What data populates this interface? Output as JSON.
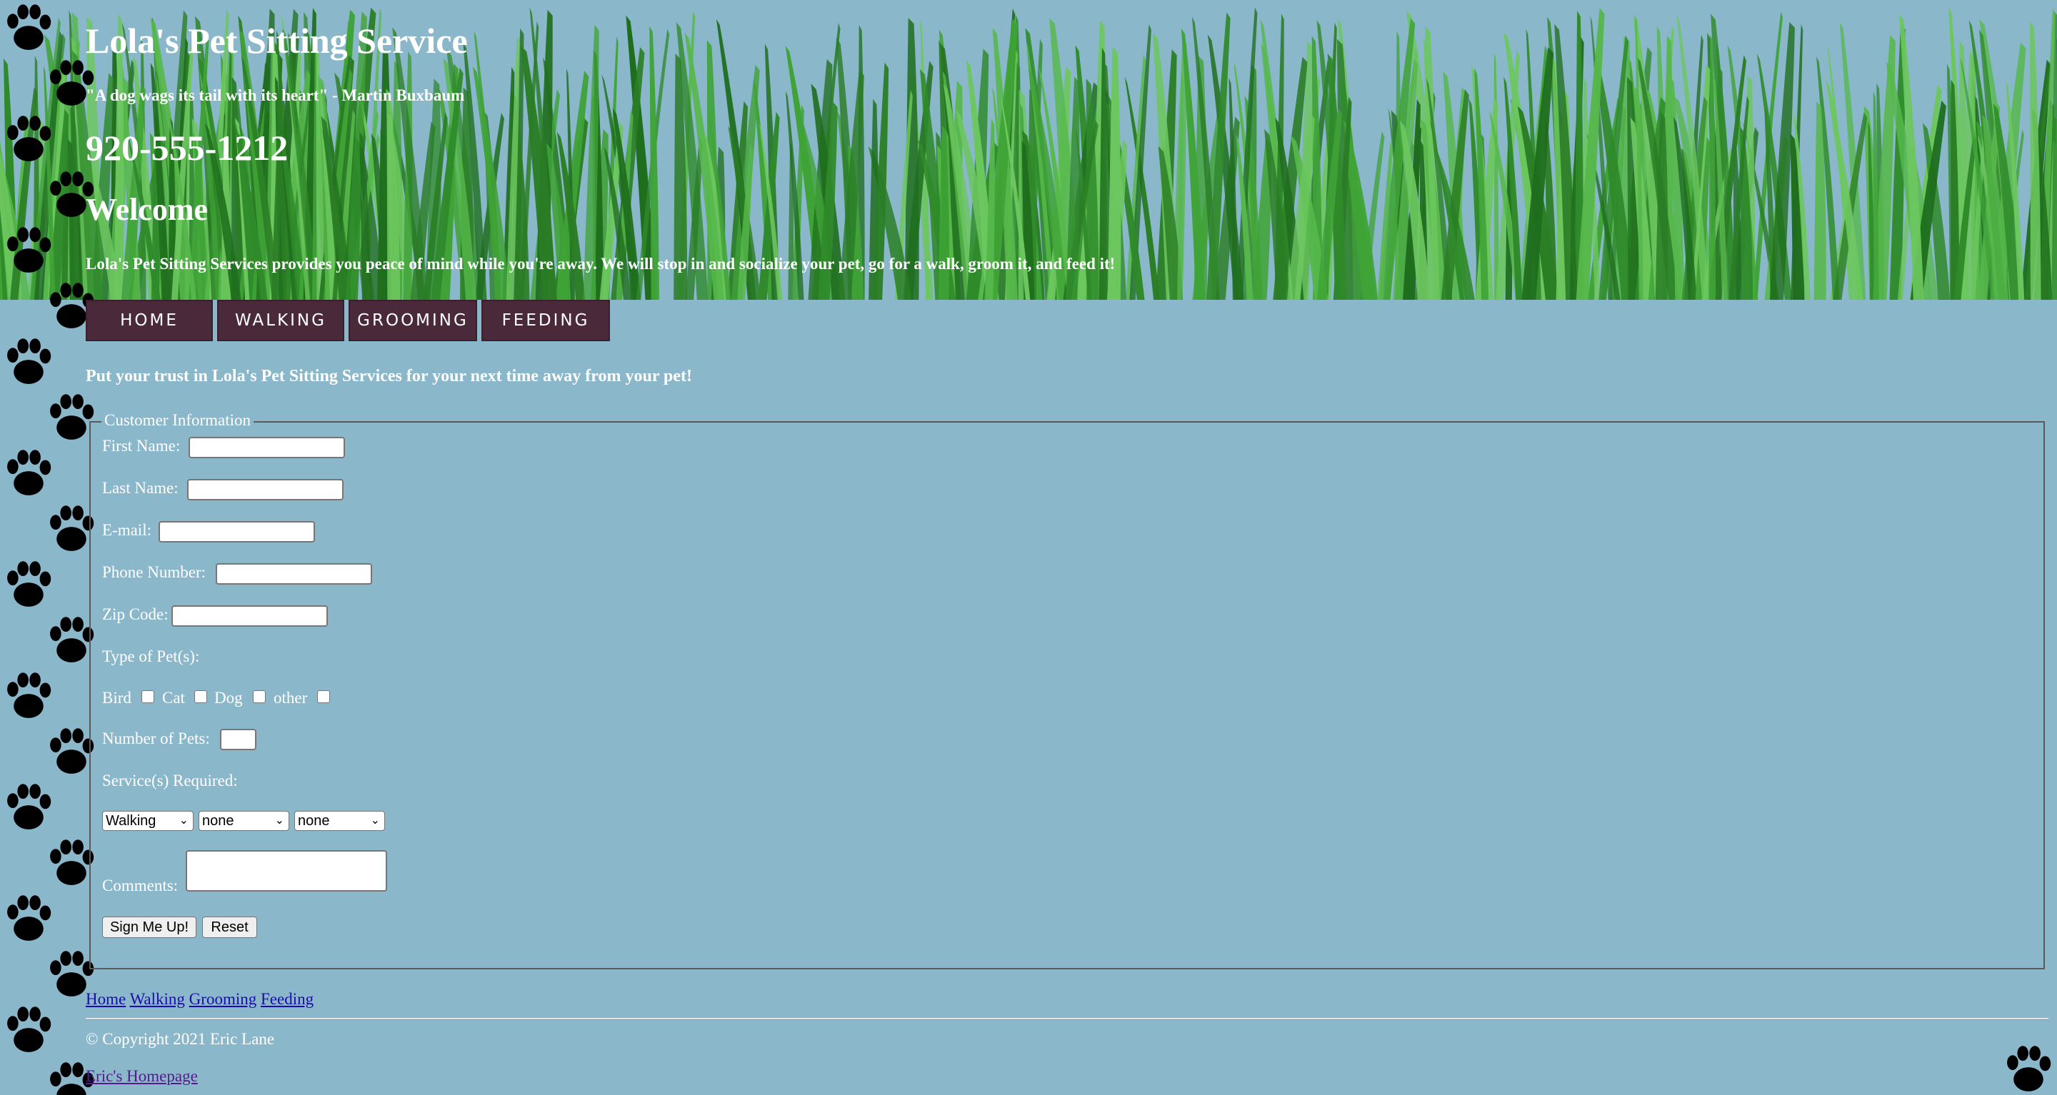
{
  "header": {
    "title": "Lola's Pet Sitting Service",
    "quote": "\"A dog wags its tail with its heart\" - Martin Buxbaum",
    "phone": "920-555-1212",
    "welcome": "Welcome",
    "intro": "Lola's Pet Sitting Services provides you peace of mind while you're away. We will stop in and socialize your pet, go for a walk, groom it, and feed it!"
  },
  "nav": {
    "items": [
      {
        "label": "HOME"
      },
      {
        "label": "WALKING"
      },
      {
        "label": "GROOMING"
      },
      {
        "label": "FEEDING"
      }
    ],
    "color": "#4a2a3a"
  },
  "trust_text": "Put your trust in Lola's Pet Sitting Services for your next time away from your pet!",
  "form": {
    "legend": "Customer Information",
    "first_name_label": "First Name:",
    "last_name_label": "Last Name:",
    "email_label": "E-mail:",
    "phone_label": "Phone Number:",
    "zip_label": "Zip Code:",
    "pet_type_label": "Type of Pet(s):",
    "pets": [
      "Bird",
      "Cat",
      "Dog",
      "other"
    ],
    "num_pets_label": "Number of Pets:",
    "services_label": "Service(s) Required:",
    "services_selected": [
      "Walking",
      "none",
      "none"
    ],
    "comments_label": "Comments:",
    "submit_label": "Sign Me Up!",
    "reset_label": "Reset"
  },
  "footer": {
    "links": [
      "Home",
      "Walking",
      "Grooming",
      "Feeding"
    ],
    "copyright": "© Copyright 2021 Eric Lane",
    "homepage": "Eric's Homepage"
  },
  "colors": {
    "background": "#8bb7cb",
    "nav_button": "#4a2a3a",
    "text": "#ffffff"
  }
}
